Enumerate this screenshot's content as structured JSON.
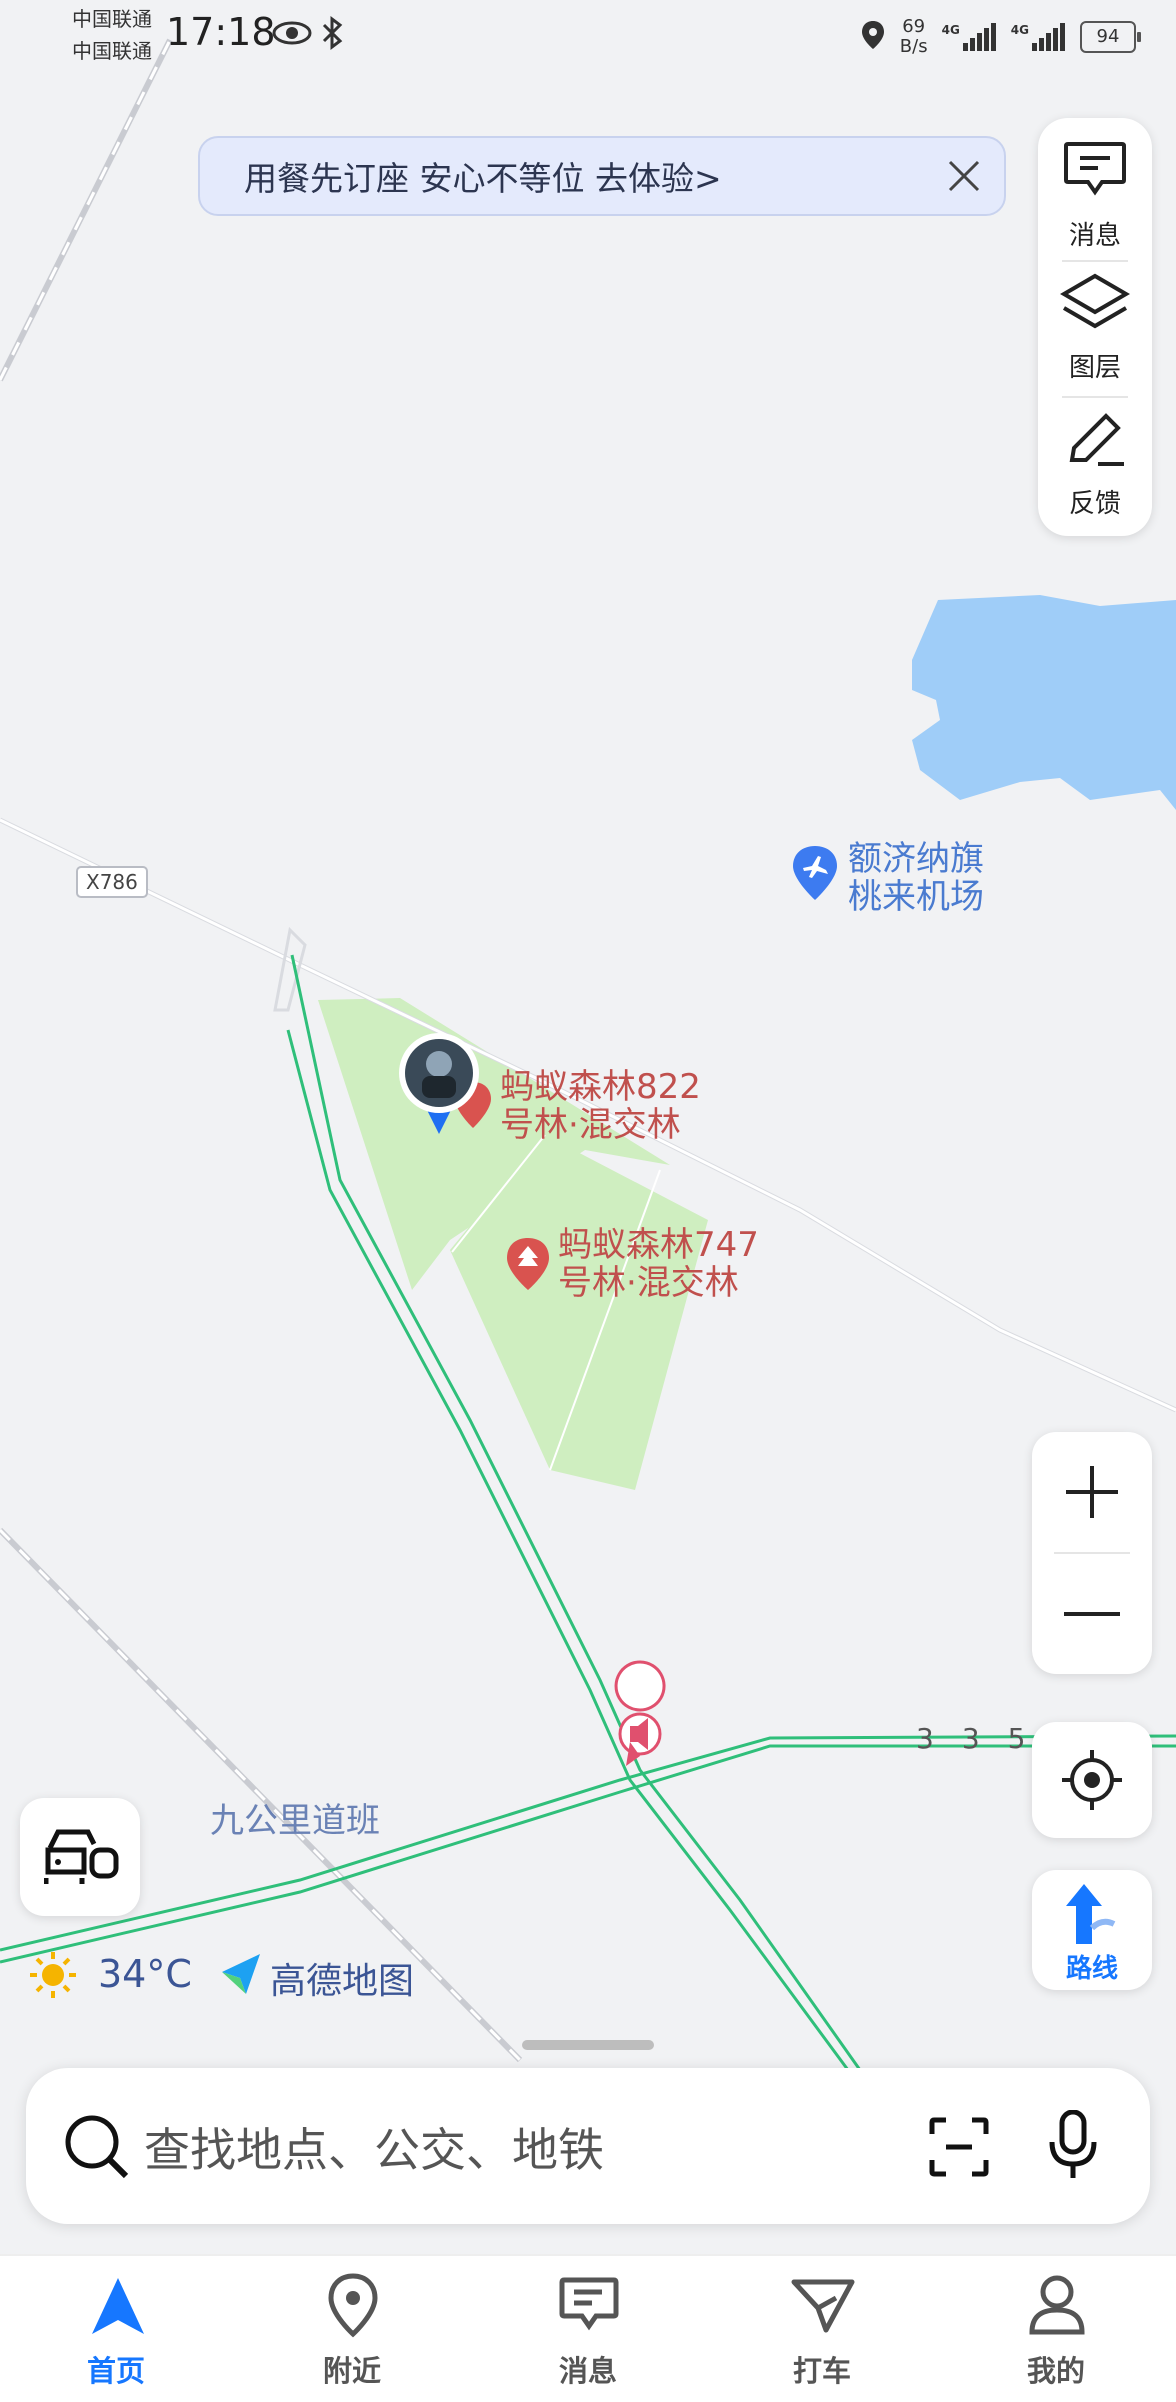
{
  "status_bar": {
    "carrier_1": "中国联通",
    "carrier_2": "中国联通",
    "time": "17:18",
    "net_speed_value": "69",
    "net_speed_unit": "B/s",
    "network_1": "4G",
    "network_2": "4G",
    "battery": "94"
  },
  "banner": {
    "text": "用餐先订座 安心不等位 去体验>"
  },
  "side_panel": {
    "messages": "消息",
    "layers": "图层",
    "feedback": "反馈"
  },
  "map": {
    "road_label": "X786",
    "airport_line1": "额济纳旗",
    "airport_line2": "桃来机场",
    "forest1_line1": "蚂蚁森林822",
    "forest1_line2": "号林·混交林",
    "forest2_line1": "蚂蚁森林747",
    "forest2_line2": "号林·混交林",
    "place_label": "九公里道班",
    "road_numbers": [
      "3",
      "3",
      "5"
    ]
  },
  "weather": {
    "temperature": "34°C"
  },
  "brand": {
    "name": "高德地图"
  },
  "controls": {
    "route_label": "路线"
  },
  "search": {
    "placeholder": "查找地点、公交、地铁"
  },
  "tabs": [
    {
      "label": "首页",
      "active": true
    },
    {
      "label": "附近",
      "active": false
    },
    {
      "label": "消息",
      "active": false
    },
    {
      "label": "打车",
      "active": false
    },
    {
      "label": "我的",
      "active": false
    }
  ],
  "colors": {
    "accent": "#1677ff",
    "forest": "#cfeec0",
    "water": "#9fcdf8",
    "route": "#2fbf7a",
    "poi_red": "#d9534f",
    "label_red": "#c0504d"
  }
}
